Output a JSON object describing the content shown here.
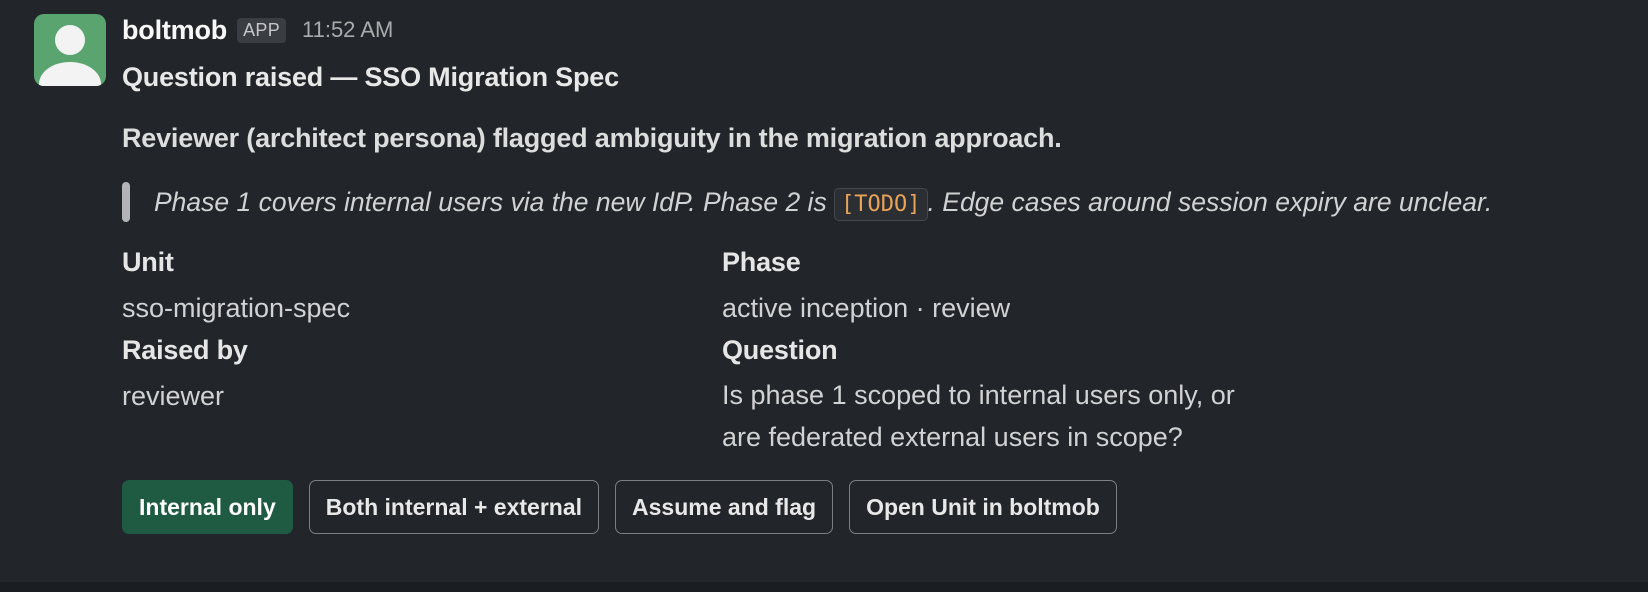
{
  "message": {
    "sender": "boltmob",
    "badge": "APP",
    "timestamp": "11:52 AM",
    "title": "Question raised — SSO Migration Spec",
    "summary": "Reviewer (architect persona) flagged ambiguity in the migration approach.",
    "quote": {
      "before": "Phase 1 covers internal users via the new IdP. Phase 2 is ",
      "code": "[TODO]",
      "after": ". Edge cases around session expiry are unclear."
    },
    "fields": {
      "unit_label": "Unit",
      "unit_value": "sso-migration-spec",
      "phase_label": "Phase",
      "phase_value": "active inception · review",
      "raised_by_label": "Raised by",
      "raised_by_value": "reviewer",
      "question_label": "Question",
      "question_line1": "Is phase 1 scoped to internal users only, or",
      "question_line2": "are federated external users in scope?"
    },
    "actions": {
      "internal_only": "Internal only",
      "both": "Both internal + external",
      "assume": "Assume and flag",
      "open_unit": "Open Unit in boltmob"
    }
  },
  "colors": {
    "background": "#222529",
    "avatar": "#5aa56f",
    "primary_button": "#1f5a43",
    "code_text": "#e8a357"
  },
  "icons": {
    "avatar": "user-silhouette-icon"
  }
}
